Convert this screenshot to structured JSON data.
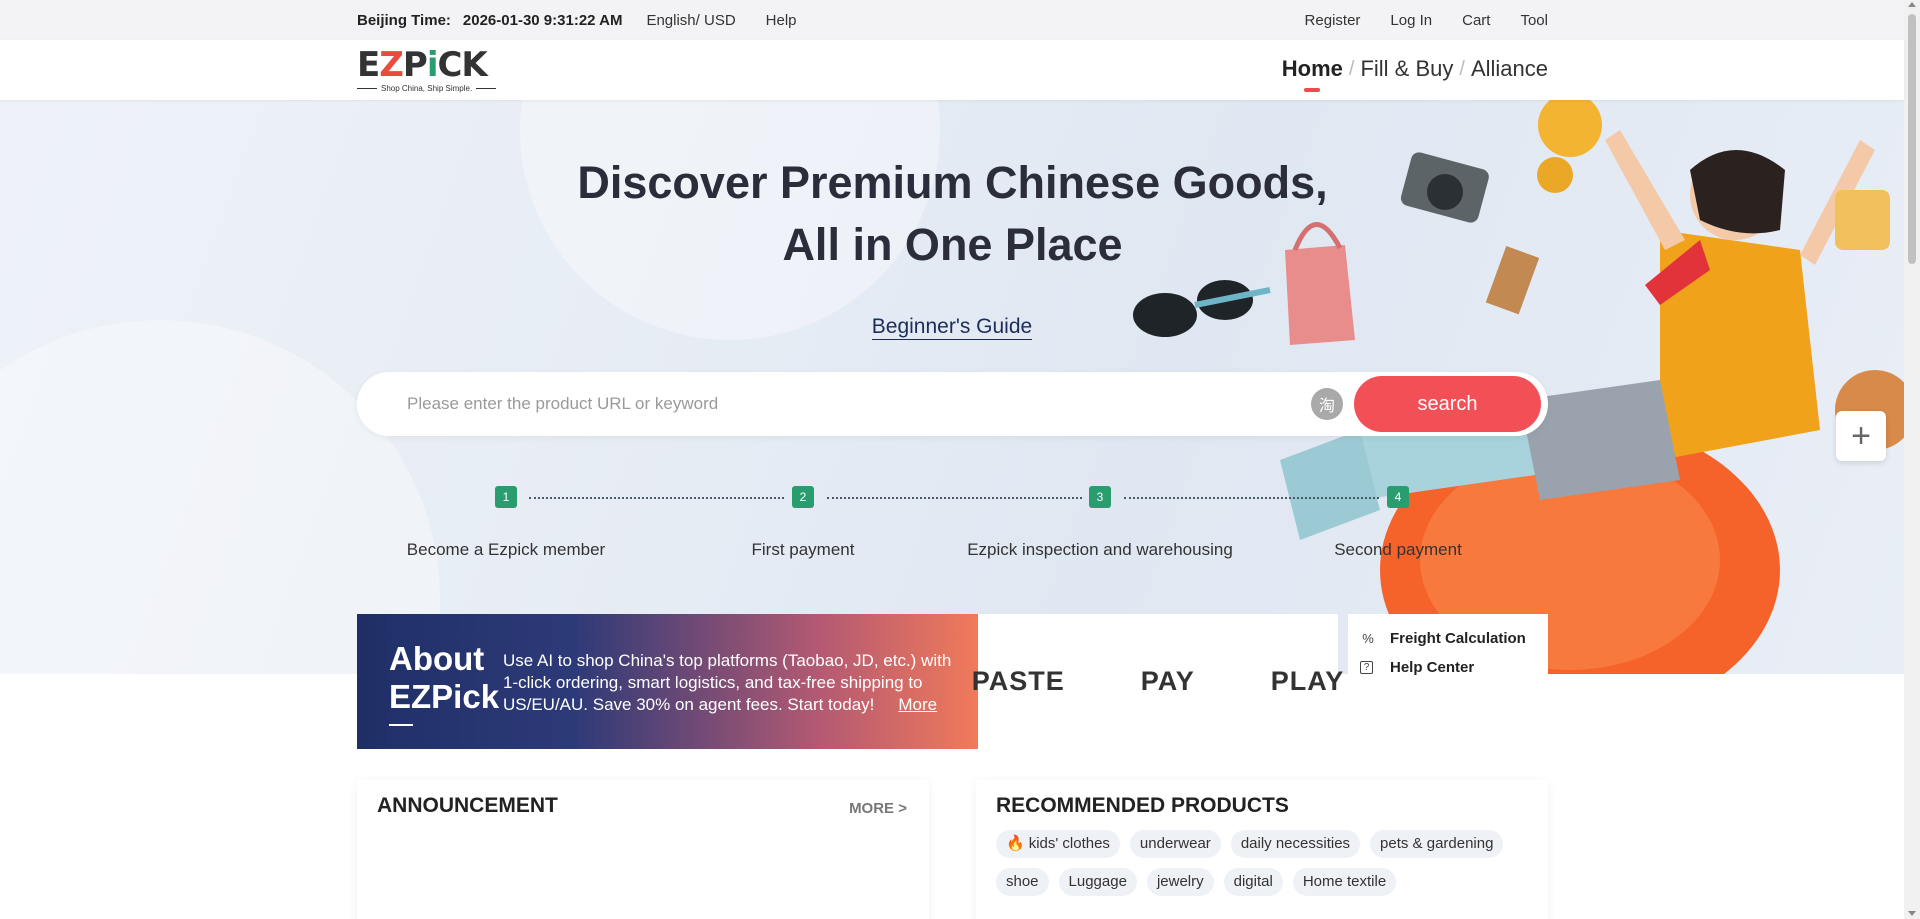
{
  "topbar": {
    "beijing_label": "Beijing Time:",
    "beijing_time": "2026-01-30 9:31:22 AM",
    "language_currency": "English/ USD",
    "help": "Help",
    "register": "Register",
    "login": "Log In",
    "cart": "Cart",
    "tool": "Tool"
  },
  "header": {
    "logo": {
      "part1": "E",
      "part2": "Z",
      "part3": "P",
      "part4": "i",
      "part5": "CK",
      "tagline": "Shop China, Ship Simple."
    },
    "nav": [
      {
        "label": "Home"
      },
      {
        "label": "Fill & Buy"
      },
      {
        "label": "Alliance"
      }
    ],
    "nav_separator": "/"
  },
  "hero": {
    "title_line1": "Discover Premium Chinese Goods,",
    "title_line2": "All in One Place",
    "guide_link": "Beginner's Guide",
    "search": {
      "placeholder": "Please enter the product URL or keyword",
      "value": "",
      "taobao_icon_char": "淘",
      "button": "search"
    },
    "steps": [
      {
        "num": "1",
        "label": "Become a Ezpick member"
      },
      {
        "num": "2",
        "label": "First payment"
      },
      {
        "num": "3",
        "label": "Ezpick inspection and warehousing"
      },
      {
        "num": "4",
        "label": "Second payment"
      }
    ]
  },
  "float_button": {
    "icon": "plus-icon",
    "symbol": "+"
  },
  "about": {
    "title_line1": "About",
    "title_line2": "EZPick",
    "description": "Use AI to shop China's top platforms (Taobao, JD, etc.) with 1-click ordering, smart logistics, and tax-free shipping to US/EU/AU. Save 30% on agent fees. Start today!",
    "more": "More"
  },
  "ppp": {
    "paste": "PASTE",
    "pay": "PAY",
    "play": "PLAY"
  },
  "tools": [
    {
      "icon": "percent-icon",
      "glyph": "%",
      "label": "Freight Calculation"
    },
    {
      "icon": "question-icon",
      "glyph": "?",
      "label": "Help Center"
    }
  ],
  "announcement": {
    "title": "ANNOUNCEMENT",
    "more": "MORE >"
  },
  "recommended": {
    "title": "RECOMMENDED PRODUCTS",
    "hot_icon": "fire-icon",
    "tags": [
      "kids' clothes",
      "underwear",
      "daily necessities",
      "pets & gardening",
      "shoe",
      "Luggage",
      "jewelry",
      "digital",
      "Home textile"
    ]
  },
  "colors": {
    "accent_red": "#f24f57",
    "step_green": "#2a9d6f",
    "link_navy": "#1d2d5a"
  }
}
